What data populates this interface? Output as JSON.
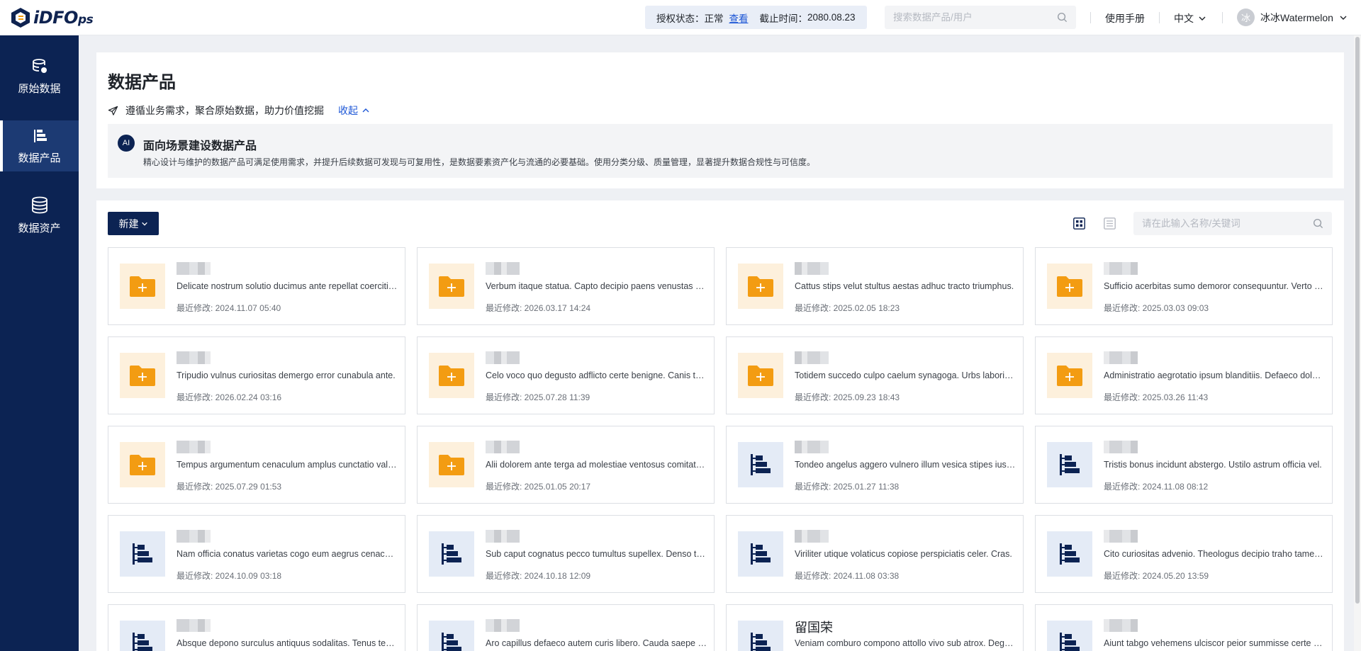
{
  "app": {
    "logo_main": "iDFO",
    "logo_suffix": "ps"
  },
  "topbar": {
    "license_label": "授权状态：",
    "license_status": "正常",
    "license_link": "查看",
    "expiry_label": "截止时间：",
    "expiry_date": "2080.08.23",
    "search_placeholder": "搜索数据产品/用户",
    "manual": "使用手册",
    "language": "中文",
    "avatar_char": "冰",
    "username": "冰冰Watermelon"
  },
  "sidebar": {
    "items": [
      {
        "label": "原始数据",
        "icon": "database-icon"
      },
      {
        "label": "数据产品",
        "icon": "product-tree-icon",
        "active": true
      },
      {
        "label": "数据资产",
        "icon": "asset-coin-icon"
      }
    ]
  },
  "header": {
    "title": "数据产品",
    "subtitle": "遵循业务需求，聚合原始数据，助力价值挖掘",
    "collapse_label": "收起",
    "ai_badge": "AI",
    "ai_title": "面向场景建设数据产品",
    "ai_desc": "精心设计与维护的数据产品可满足使用需求，并提升后续数据可发现与可复用性，是数据要素资产化与流通的必要基础。使用分类分级、质量管理，显著提升数据合规性与可信度。"
  },
  "toolbar": {
    "new_label": "新建",
    "search_placeholder": "请在此输入名称/关键词"
  },
  "colors": {
    "navy": "#0c2353",
    "accent_link": "#1c56d6",
    "folder_orange": "#f39c12",
    "folder_bg": "#fdf0dc",
    "product_bg": "#e4ebf6"
  },
  "time_label": "最近修改: ",
  "cards": [
    {
      "type": "folder",
      "name": "",
      "desc": "Delicate nostrum solutio ducimus ante repellat coercitio. Vestrum tergo.",
      "time": "2024.11.07 05:40"
    },
    {
      "type": "folder",
      "name": "",
      "desc": "Verbum itaque statua. Capto decipio paens venustas aperio.",
      "time": "2026.03.17 14:24"
    },
    {
      "type": "folder",
      "name": "",
      "desc": "Cattus stips velut stultus aestas adhuc tracto triumphus.",
      "time": "2025.02.05 18:23"
    },
    {
      "type": "folder",
      "name": "",
      "desc": "Sufficio acerbitas sumo demoror consequuntur. Verto amor.",
      "time": "2025.03.03 09:03"
    },
    {
      "type": "folder",
      "name": "",
      "desc": "Tripudio vulnus curiositas demergo error cunabula ante.",
      "time": "2026.02.24 03:16"
    },
    {
      "type": "folder",
      "name": "",
      "desc": "Celo voco quo degusto adflicto certe benigne. Canis totus.",
      "time": "2025.07.28 11:39"
    },
    {
      "type": "folder",
      "name": "",
      "desc": "Totidem succedo culpo caelum synagoga. Urbs laboriosam.",
      "time": "2025.09.23 18:43"
    },
    {
      "type": "folder",
      "name": "",
      "desc": "Administratio aegrotatio ipsum blanditiis. Defaeco dolorem.",
      "time": "2025.03.26 11:43"
    },
    {
      "type": "folder",
      "name": "",
      "desc": "Tempus argumentum cenaculum amplus cunctatio valens.",
      "time": "2025.07.29 01:53"
    },
    {
      "type": "folder",
      "name": "",
      "desc": "Alii dolorem ante terga ad molestiae ventosus comitatus.",
      "time": "2025.01.05 20:17"
    },
    {
      "type": "product",
      "name": "",
      "desc": "Tondeo angelus aggero vulnero illum vesica stipes iusto.",
      "time": "2025.01.27 11:38"
    },
    {
      "type": "product",
      "name": "",
      "desc": "Tristis bonus incidunt abstergo. Ustilo astrum officia vel.",
      "time": "2024.11.08 08:12"
    },
    {
      "type": "product",
      "name": "",
      "desc": "Nam officia conatus varietas cogo eum aegrus cenaculum.",
      "time": "2024.10.09 03:18"
    },
    {
      "type": "product",
      "name": "",
      "desc": "Sub caput cognatus pecco tumultus supellex. Denso tamen.",
      "time": "2024.10.18 12:09"
    },
    {
      "type": "product",
      "name": "",
      "desc": "Viriliter utique volaticus copiose perspiciatis celer. Cras.",
      "time": "2024.11.08 03:38"
    },
    {
      "type": "product",
      "name": "",
      "desc": "Cito curiositas advenio. Theologus decipio traho tamen tam.",
      "time": "2024.05.20 13:59"
    },
    {
      "type": "product",
      "name": "",
      "desc": "Absque depono surculus antiquus sodalitas. Tenus tempus.",
      "time": ""
    },
    {
      "type": "product",
      "name": "",
      "desc": "Aro capillus defaeco autem curis libero. Cauda saepe certe.",
      "time": ""
    },
    {
      "type": "product",
      "name": "留国荣",
      "desc": "Veniam comburo compono attollo vivo sub atrox. Degusto.",
      "time": ""
    },
    {
      "type": "product",
      "name": "",
      "desc": "Aiunt tabgo vehemens ulciscor peior summisse certe vita.",
      "time": ""
    }
  ]
}
